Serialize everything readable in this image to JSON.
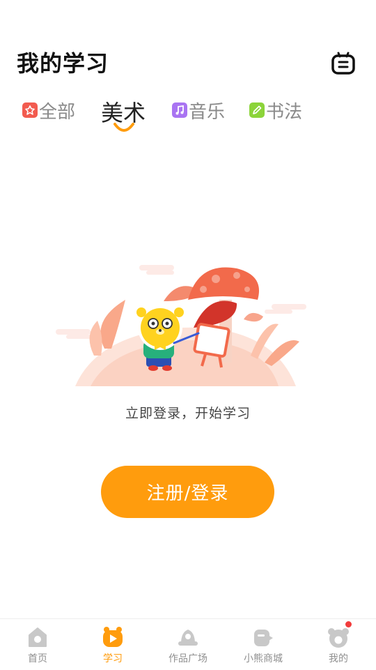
{
  "header": {
    "title": "我的学习",
    "robot_icon": "robot-icon"
  },
  "tabs": [
    {
      "label": "全部",
      "icon": "flower-icon",
      "color": "#f25b4f",
      "active": false
    },
    {
      "label": "美术",
      "icon": "",
      "color": "#ff9c0d",
      "active": true
    },
    {
      "label": "音乐",
      "icon": "music-note-icon",
      "color": "#a974f2",
      "active": false
    },
    {
      "label": "书法",
      "icon": "pen-icon",
      "color": "#8cd43a",
      "active": false
    }
  ],
  "main": {
    "illustration": "bear-with-mushrooms-illustration",
    "prompt": "立即登录，开始学习",
    "login_button": "注册/登录"
  },
  "bottom_nav": [
    {
      "label": "首页",
      "icon": "home-icon",
      "active": false
    },
    {
      "label": "学习",
      "icon": "study-icon",
      "active": true
    },
    {
      "label": "作品广场",
      "icon": "gallery-icon",
      "active": false
    },
    {
      "label": "小熊商城",
      "icon": "shop-icon",
      "active": false
    },
    {
      "label": "我的",
      "icon": "bear-face-icon",
      "active": false,
      "badge": true
    }
  ],
  "colors": {
    "accent": "#ff9c0d",
    "badge": "#f23c3c"
  }
}
